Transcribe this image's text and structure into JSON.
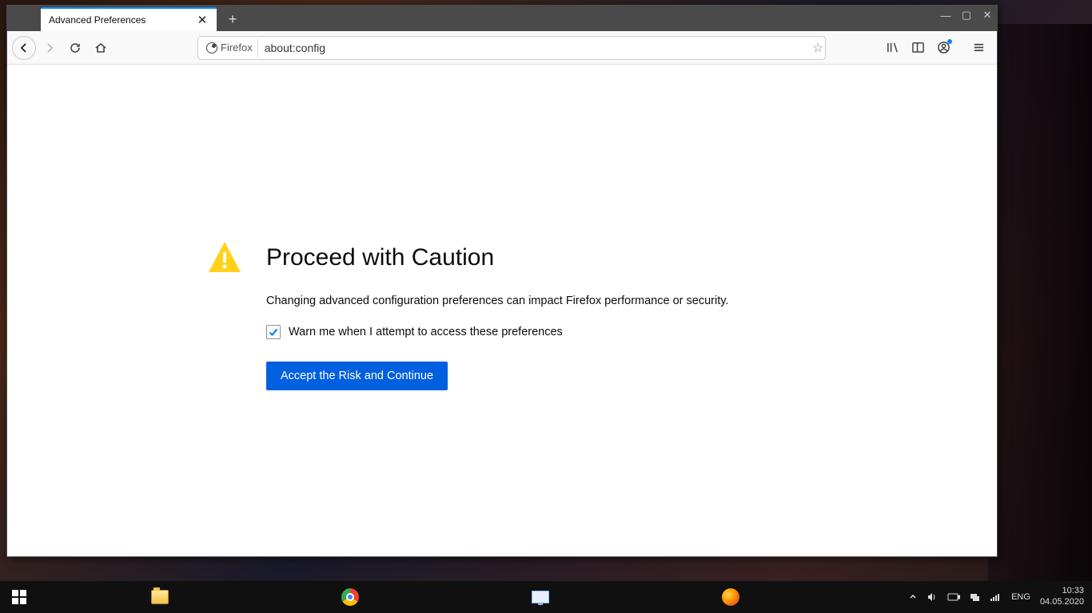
{
  "window": {
    "tab_title": "Advanced Preferences"
  },
  "toolbar": {
    "identity_label": "Firefox",
    "url": "about:config"
  },
  "page": {
    "title": "Proceed with Caution",
    "description": "Changing advanced configuration preferences can impact Firefox performance or security.",
    "checkbox_label": "Warn me when I attempt to access these preferences",
    "checkbox_checked": true,
    "accept_button": "Accept the Risk and Continue"
  },
  "tray": {
    "language": "ENG",
    "time": "10:33",
    "date": "04.05.2020"
  }
}
